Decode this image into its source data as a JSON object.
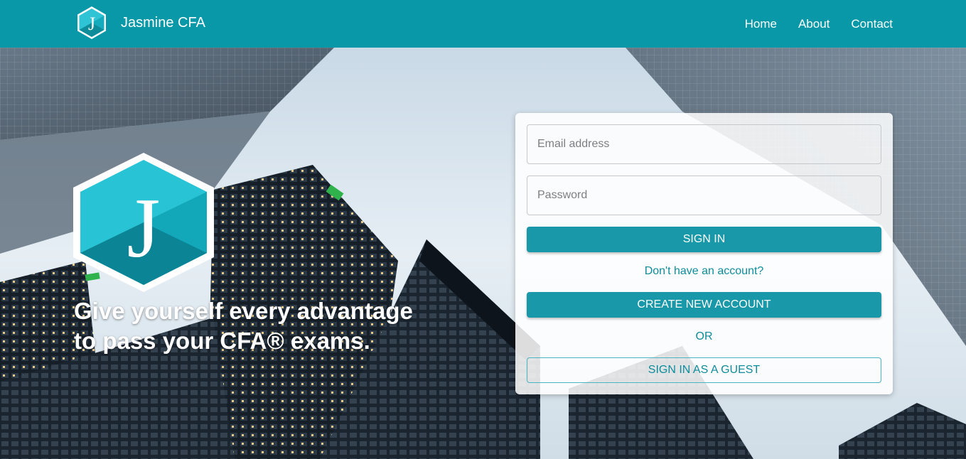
{
  "nav": {
    "brand_name": "Jasmine CFA",
    "logo_letter": "J",
    "links": [
      "Home",
      "About",
      "Contact"
    ]
  },
  "hero": {
    "logo_letter": "J",
    "tagline_line1": "Give yourself every advantage",
    "tagline_line2": "to pass your CFA® exams."
  },
  "login": {
    "email_placeholder": "Email address",
    "password_placeholder": "Password",
    "sign_in_label": "SIGN IN",
    "no_account_text": "Don't have an account?",
    "create_account_label": "CREATE NEW ACCOUNT",
    "or_text": "OR",
    "guest_label": "SIGN IN AS A GUEST"
  },
  "colors": {
    "brand_teal": "#0898a8",
    "button_teal": "#1898a8",
    "link_teal": "#0f8c9c"
  }
}
